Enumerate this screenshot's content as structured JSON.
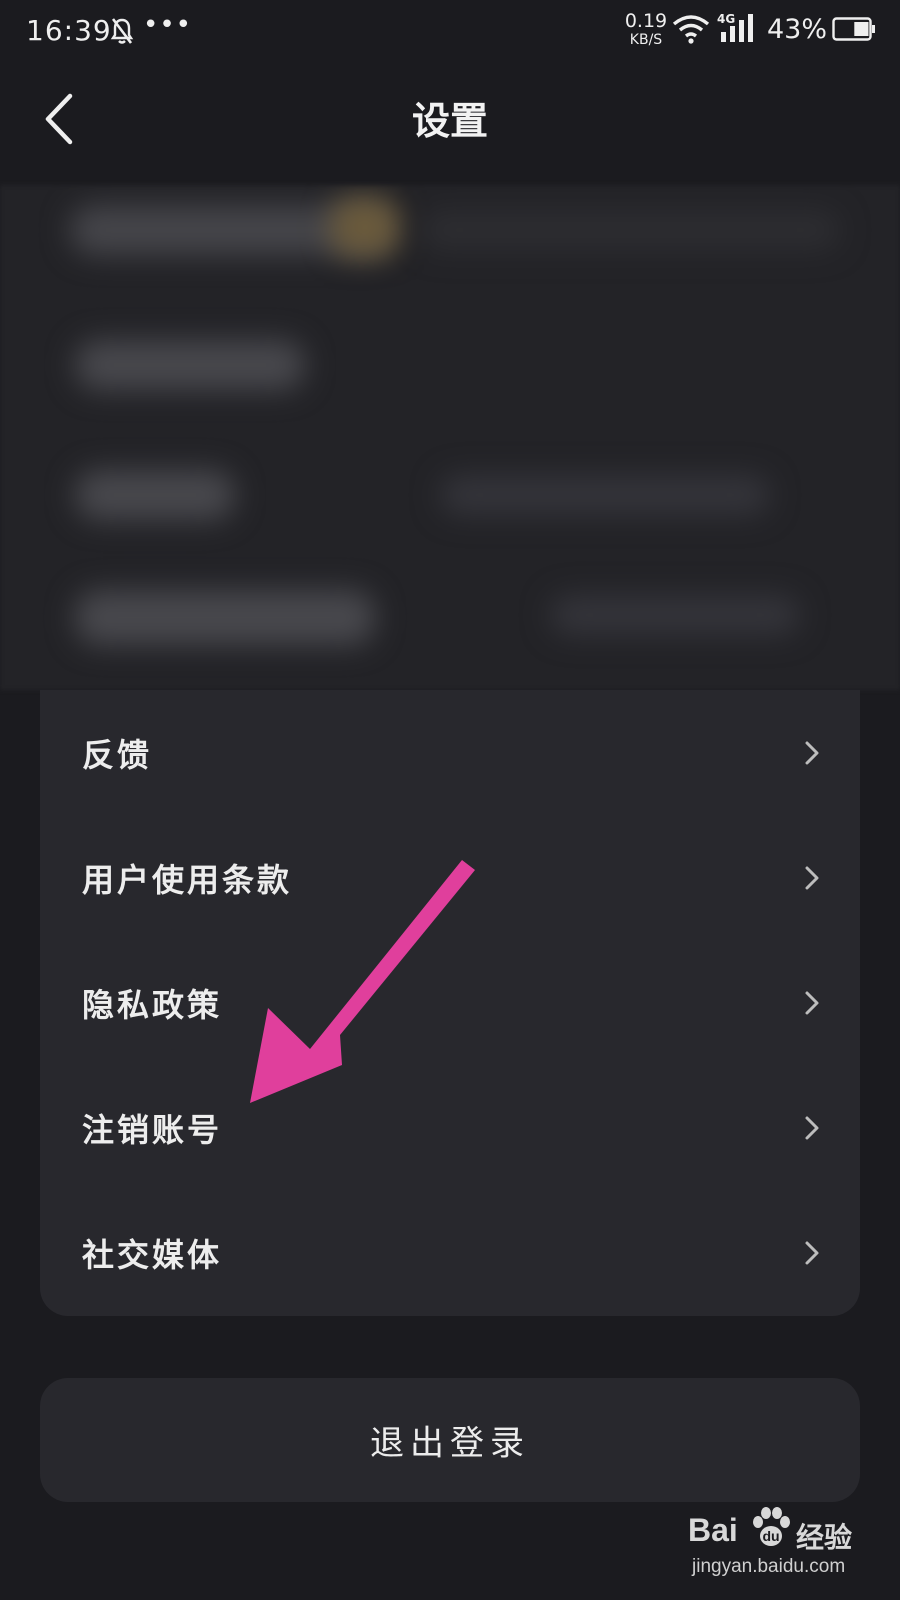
{
  "status_bar": {
    "time": "16:39",
    "more_indicator": "•••",
    "net_speed_value": "0.19",
    "net_speed_unit": "KB/S",
    "network_type": "4G",
    "battery_percent": "43%",
    "battery_level": 0.43,
    "icons": [
      "bell-mute-icon",
      "wifi-icon",
      "cellular-signal-icon",
      "battery-icon"
    ]
  },
  "header": {
    "title": "设置",
    "back_icon": "chevron-left-icon"
  },
  "settings": {
    "items": [
      {
        "label": "反馈"
      },
      {
        "label": "用户使用条款"
      },
      {
        "label": "隐私政策"
      },
      {
        "label": "注销账号"
      },
      {
        "label": "社交媒体"
      }
    ],
    "chevron_icon": "chevron-right-icon"
  },
  "logout": {
    "label": "退出登录"
  },
  "annotation": {
    "color": "#e03f9c"
  },
  "watermark": {
    "brand": "Bai",
    "brand_cn": "经验",
    "url": "jingyan.baidu.com"
  },
  "colors": {
    "background": "#1b1b1f",
    "card": "#28282d",
    "text": "#ececec"
  }
}
